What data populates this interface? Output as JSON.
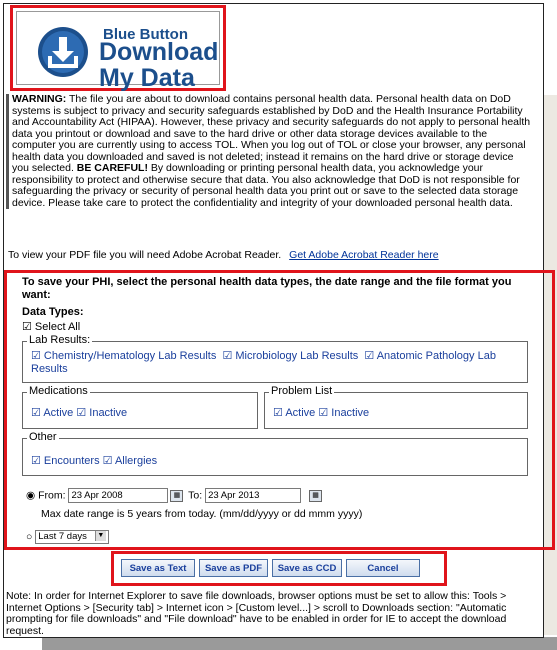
{
  "logo": {
    "line1": "Blue Button",
    "line2": "Download",
    "line3": "My Data"
  },
  "warning": {
    "label": "WARNING:",
    "text1": " The file you are about to download contains personal health data. Personal health data on DoD systems is subject to privacy and security safeguards established by DoD and the Health Insurance Portability and Accountability Act (HIPAA). However, these privacy and security safeguards do not apply to personal health data you printout or download and save to the hard drive or other data storage devices available to the computer you are currently using to access TOL. When you log out of TOL or close your browser, any personal health data you downloaded and saved is not deleted; instead it remains on the hard drive or storage device you selected. ",
    "careful": "BE CAREFUL!",
    "text2": " By downloading or printing personal health data, you acknowledge your responsibility to protect and otherwise secure that data. You also acknowledge that DoD is not responsible for safeguarding the privacy or security of personal health data you print out or save to the selected data storage device. Please take care to protect the confidentiality and integrity of your downloaded personal health data."
  },
  "pdf": {
    "text": "To view your PDF file you will need Adobe Acrobat Reader.",
    "link": "Get Adobe Acrobat Reader here"
  },
  "instruction": "To save your PHI, select the personal health data types, the date range and the file format you want:",
  "data_types": {
    "label": "Data Types:",
    "select_all": "Select All"
  },
  "lab": {
    "legend": "Lab Results:",
    "items": [
      "Chemistry/Hematology Lab Results",
      "Microbiology Lab Results",
      "Anatomic Pathology Lab Results"
    ]
  },
  "medications": {
    "legend": "Medications",
    "active": "Active",
    "inactive": "Inactive"
  },
  "problems": {
    "legend": "Problem List",
    "active": "Active",
    "inactive": "Inactive"
  },
  "other": {
    "legend": "Other",
    "items": [
      "Encounters",
      "Allergies"
    ]
  },
  "date": {
    "from_label": "From:",
    "from_value": "23 Apr 2008",
    "to_label": "To:",
    "to_value": "23 Apr 2013",
    "max_note": "Max date range is 5 years from today. (mm/dd/yyyy or dd mmm yyyy)",
    "last_option": "Last 7 days"
  },
  "buttons": {
    "text": "Save as Text",
    "pdf": "Save as PDF",
    "ccd": "Save as CCD",
    "cancel": "Cancel"
  },
  "note": "Note: In order for Internet Explorer to save file downloads, browser options must be set to allow this: Tools > Internet Options > [Security tab] > Internet icon > [Custom level...] > scroll to Downloads section: \"Automatic prompting for file downloads\" and \"File download\" have to be enabled in order for IE to accept the download request.",
  "colors": {
    "highlight": "#e0141b",
    "link": "#003399",
    "brand": "#1c4f8c"
  }
}
